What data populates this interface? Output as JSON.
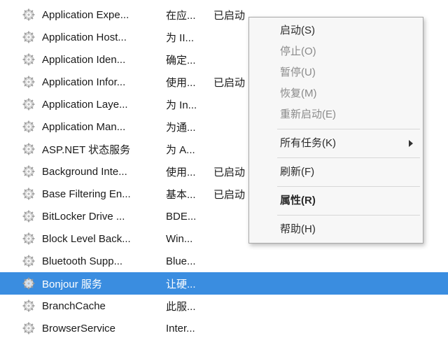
{
  "services": [
    {
      "name": "Application Expe...",
      "desc": "在应...",
      "status": "已启动"
    },
    {
      "name": "Application Host...",
      "desc": "为 II...",
      "status": ""
    },
    {
      "name": "Application Iden...",
      "desc": "确定...",
      "status": ""
    },
    {
      "name": "Application Infor...",
      "desc": "使用...",
      "status": "已启动"
    },
    {
      "name": "Application Laye...",
      "desc": "为 In...",
      "status": ""
    },
    {
      "name": "Application Man...",
      "desc": "为通...",
      "status": ""
    },
    {
      "name": "ASP.NET 状态服务",
      "desc": "为 A...",
      "status": ""
    },
    {
      "name": "Background Inte...",
      "desc": "使用...",
      "status": "已启动"
    },
    {
      "name": "Base Filtering En...",
      "desc": "基本...",
      "status": "已启动"
    },
    {
      "name": "BitLocker Drive ...",
      "desc": "BDE...",
      "status": ""
    },
    {
      "name": "Block Level Back...",
      "desc": "Win...",
      "status": ""
    },
    {
      "name": "Bluetooth Supp...",
      "desc": "Blue...",
      "status": ""
    },
    {
      "name": "Bonjour 服务",
      "desc": "让硬...",
      "status": "",
      "selected": true
    },
    {
      "name": "BranchCache",
      "desc": "此服...",
      "status": ""
    },
    {
      "name": "BrowserService",
      "desc": "Inter...",
      "status": ""
    }
  ],
  "menu": {
    "start": "启动(S)",
    "stop": "停止(O)",
    "pause": "暂停(U)",
    "resume": "恢复(M)",
    "restart": "重新启动(E)",
    "alltasks": "所有任务(K)",
    "refresh": "刷新(F)",
    "props": "属性(R)",
    "help": "帮助(H)"
  }
}
